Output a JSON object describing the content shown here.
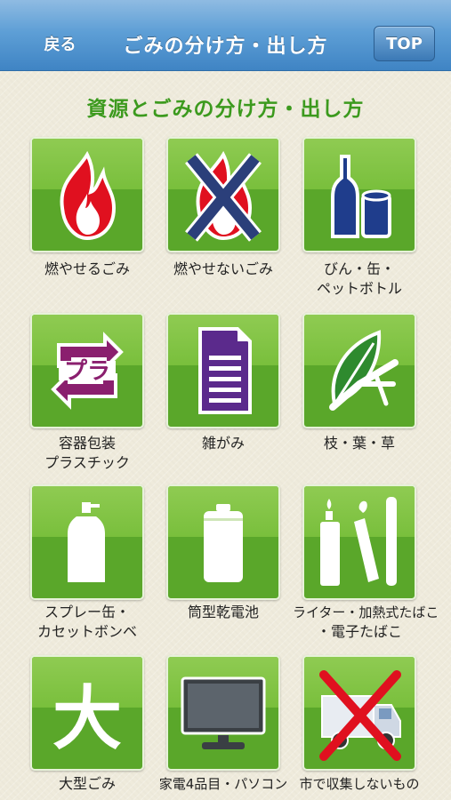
{
  "nav": {
    "back_label": "戻る",
    "title": "ごみの分け方・出し方",
    "top_label": "TOP"
  },
  "heading": "資源とごみの分け方・出し方",
  "categories": [
    {
      "lines": [
        "燃やせるごみ",
        ""
      ],
      "icon": "fire-icon"
    },
    {
      "lines": [
        "燃やせないごみ",
        ""
      ],
      "icon": "crossed-fire-icon"
    },
    {
      "lines": [
        "びん・缶・",
        "ペットボトル"
      ],
      "icon": "bottle-can-icon"
    },
    {
      "lines": [
        "容器包装",
        "プラスチック"
      ],
      "icon": "plastic-recycle-icon",
      "icon_text": "プラ"
    },
    {
      "lines": [
        "雑がみ",
        ""
      ],
      "icon": "paper-icon"
    },
    {
      "lines": [
        "枝・葉・草",
        ""
      ],
      "icon": "leaf-icon"
    },
    {
      "lines": [
        "スプレー缶・",
        "カセットボンベ"
      ],
      "icon": "spray-can-icon"
    },
    {
      "lines": [
        "筒型乾電池",
        ""
      ],
      "icon": "battery-icon"
    },
    {
      "lines": [
        "ライター・加熱式たばこ",
        "・電子たばこ"
      ],
      "icon": "lighter-ecig-icon"
    },
    {
      "lines": [
        "大型ごみ",
        ""
      ],
      "icon": "large-waste-icon",
      "icon_text": "大"
    },
    {
      "lines": [
        "家電4品目・パソコン",
        ""
      ],
      "icon": "tv-icon"
    },
    {
      "lines": [
        "市で収集しないもの",
        ""
      ],
      "icon": "crossed-truck-icon"
    }
  ]
}
